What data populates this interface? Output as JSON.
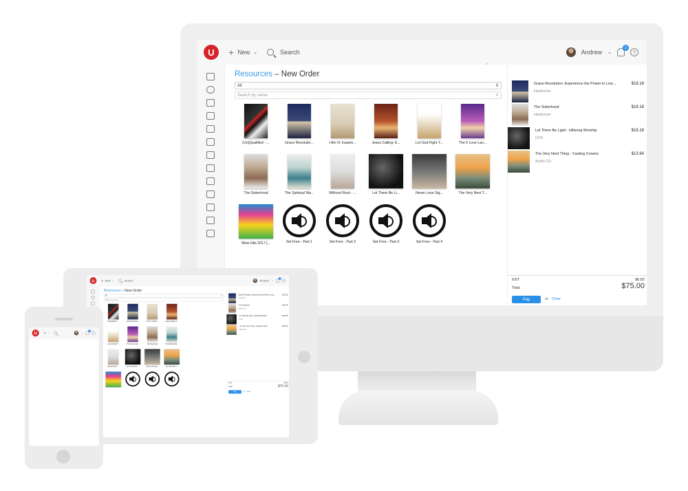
{
  "app": {
    "brand_letter": "U",
    "new_label": "New",
    "search_label": "Search",
    "user_name": "Andrew",
    "notification_count": "2",
    "help_glyph": "?"
  },
  "breadcrumb": {
    "section": "Resources",
    "separator": " – ",
    "page": "New Order"
  },
  "filter": {
    "value": "All"
  },
  "search": {
    "placeholder": "Search by name"
  },
  "sidebar_icons": [
    "monitor-icon",
    "user-icon",
    "home-icon",
    "people-icon",
    "calendar-icon",
    "calendar-day-icon",
    "mail-icon",
    "edit-icon",
    "history-icon",
    "card-icon",
    "cart-icon",
    "clipboard-icon",
    "upload-icon",
    "sync-icon"
  ],
  "products": [
    {
      "name": "(Un)Qualified - ...",
      "cover": "b1"
    },
    {
      "name": "Grace Revolutio...",
      "cover": "b2"
    },
    {
      "name": "I Am N: Inspirin...",
      "cover": "b3"
    },
    {
      "name": "Jesus Calling: E...",
      "cover": "b4"
    },
    {
      "name": "Let God Fight Y...",
      "cover": "b5"
    },
    {
      "name": "The 5 Love Lan...",
      "cover": "b6"
    },
    {
      "name": "The Sisterhood",
      "cover": "b7"
    },
    {
      "name": "The Spiritual Wa...",
      "cover": "b8"
    },
    {
      "name": "Without Rival - ...",
      "cover": "b9"
    },
    {
      "name": "Let There Be Li...",
      "cover": "b10",
      "square": true
    },
    {
      "name": "Never Lose Sig...",
      "cover": "b11",
      "square": true
    },
    {
      "name": "The Very Next T...",
      "cover": "b12",
      "square": true
    },
    {
      "name": "Wow Hits 2017 [...",
      "cover": "b13",
      "square": true
    },
    {
      "name": "Set Free - Part 1",
      "audio": true
    },
    {
      "name": "Set Free - Part 2",
      "audio": true
    },
    {
      "name": "Set Free - Part 3",
      "audio": true
    },
    {
      "name": "Set Free - Part 4",
      "audio": true
    }
  ],
  "tablet_products": [
    {
      "name": "(Un)Qualified - ...",
      "cover": "b1"
    },
    {
      "name": "Grace Revolutio...",
      "cover": "b2"
    },
    {
      "name": "I Am N: Inspirin...",
      "cover": "b3"
    },
    {
      "name": "Jesus Calling: E...",
      "cover": "b4"
    },
    {
      "name": "Let God Fight Y...",
      "cover": "b5"
    },
    {
      "name": "The 5 Love Lan...",
      "cover": "b6"
    },
    {
      "name": "The Sisterhood",
      "cover": "b7"
    },
    {
      "name": "The Spiritual Wa...",
      "cover": "b8"
    },
    {
      "name": "Without Rival - ...",
      "cover": "b9"
    },
    {
      "name": "Let There Be Li...",
      "cover": "b10",
      "square": true
    },
    {
      "name": "Never Lose Sig...",
      "cover": "b11",
      "square": true
    },
    {
      "name": "The Very Next T...",
      "cover": "b12",
      "square": true
    },
    {
      "name": "",
      "cover": "b13",
      "square": true
    },
    {
      "name": "",
      "audio": true
    },
    {
      "name": "",
      "audio": true
    },
    {
      "name": "",
      "audio": true
    }
  ],
  "cart": {
    "items": [
      {
        "name": "Grace Revolution: Experience the Power to Live...",
        "format": "Hardcover",
        "price": "$18.18",
        "cover": "b2"
      },
      {
        "name": "The Sisterhood",
        "format": "Hardcover",
        "price": "$18.18",
        "cover": "b7"
      },
      {
        "name": "Let There Be Light - Hillsong Worship",
        "format": "DVD",
        "price": "$18.18",
        "cover": "b10",
        "square": true
      },
      {
        "name": "The Very Next Thing - Casting Crowns",
        "format": "Audio CD",
        "price": "$13.64",
        "cover": "b12",
        "square": true
      }
    ],
    "gst_label": "GST",
    "gst_value": "$6.82",
    "total_label": "Total",
    "total_value": "$75.00",
    "pay_label": "Pay",
    "or_label": "or",
    "clear_label": "Clear"
  },
  "phone": {
    "extra_label": "Add"
  }
}
